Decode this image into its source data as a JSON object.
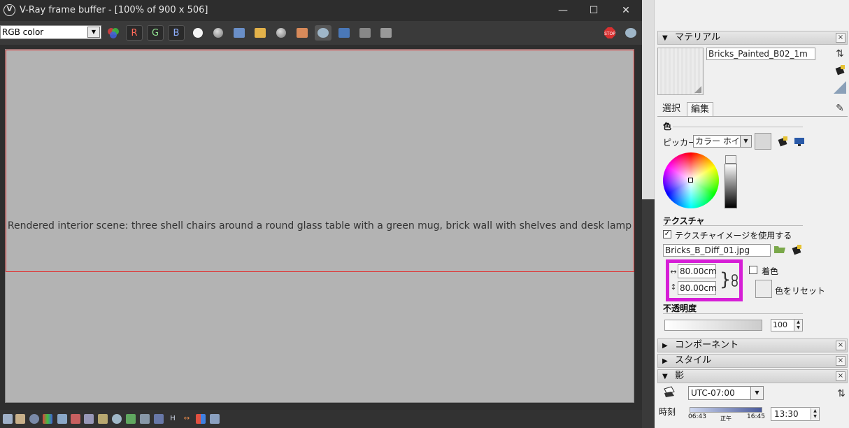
{
  "vfb": {
    "title": "V-Ray frame buffer - [100% of 900 x 506]",
    "channel": "RGB color",
    "buttons": {
      "r": "R",
      "g": "G",
      "b": "B"
    },
    "render_image_label": "Rendered interior scene: three shell chairs around a round glass table with a green mug, brick wall with shelves and desk lamp",
    "bottom_glyphs": {
      "h": "H"
    }
  },
  "tray": {
    "material_section": {
      "title": "マテリアル",
      "material_name": "Bricks_Painted_B02_1m",
      "tabs": [
        "選択",
        "編集"
      ],
      "color_label": "色",
      "picker_label": "ピッカー:",
      "picker_value": "カラー ホイール",
      "texture_label": "テクスチャ",
      "use_texture_label": "テクスチャイメージを使用する",
      "texture_file": "Bricks_B_Diff_01.jpg",
      "width": "80.00cm",
      "height": "80.00cm",
      "colorize_label": "着色",
      "reset_color_label": "色をリセット",
      "opacity_label": "不透明度",
      "opacity_value": "100"
    },
    "components_section": {
      "title": "コンポーネント"
    },
    "styles_section": {
      "title": "スタイル"
    },
    "shadows_section": {
      "title": "影",
      "timezone": "UTC-07:00",
      "time_label": "時刻",
      "time_start": "06:43",
      "time_noon": "正午",
      "time_end": "16:45",
      "time_value": "13:30"
    }
  },
  "colors": {
    "highlight": "#d61ed6",
    "render_region": "#e03030"
  }
}
